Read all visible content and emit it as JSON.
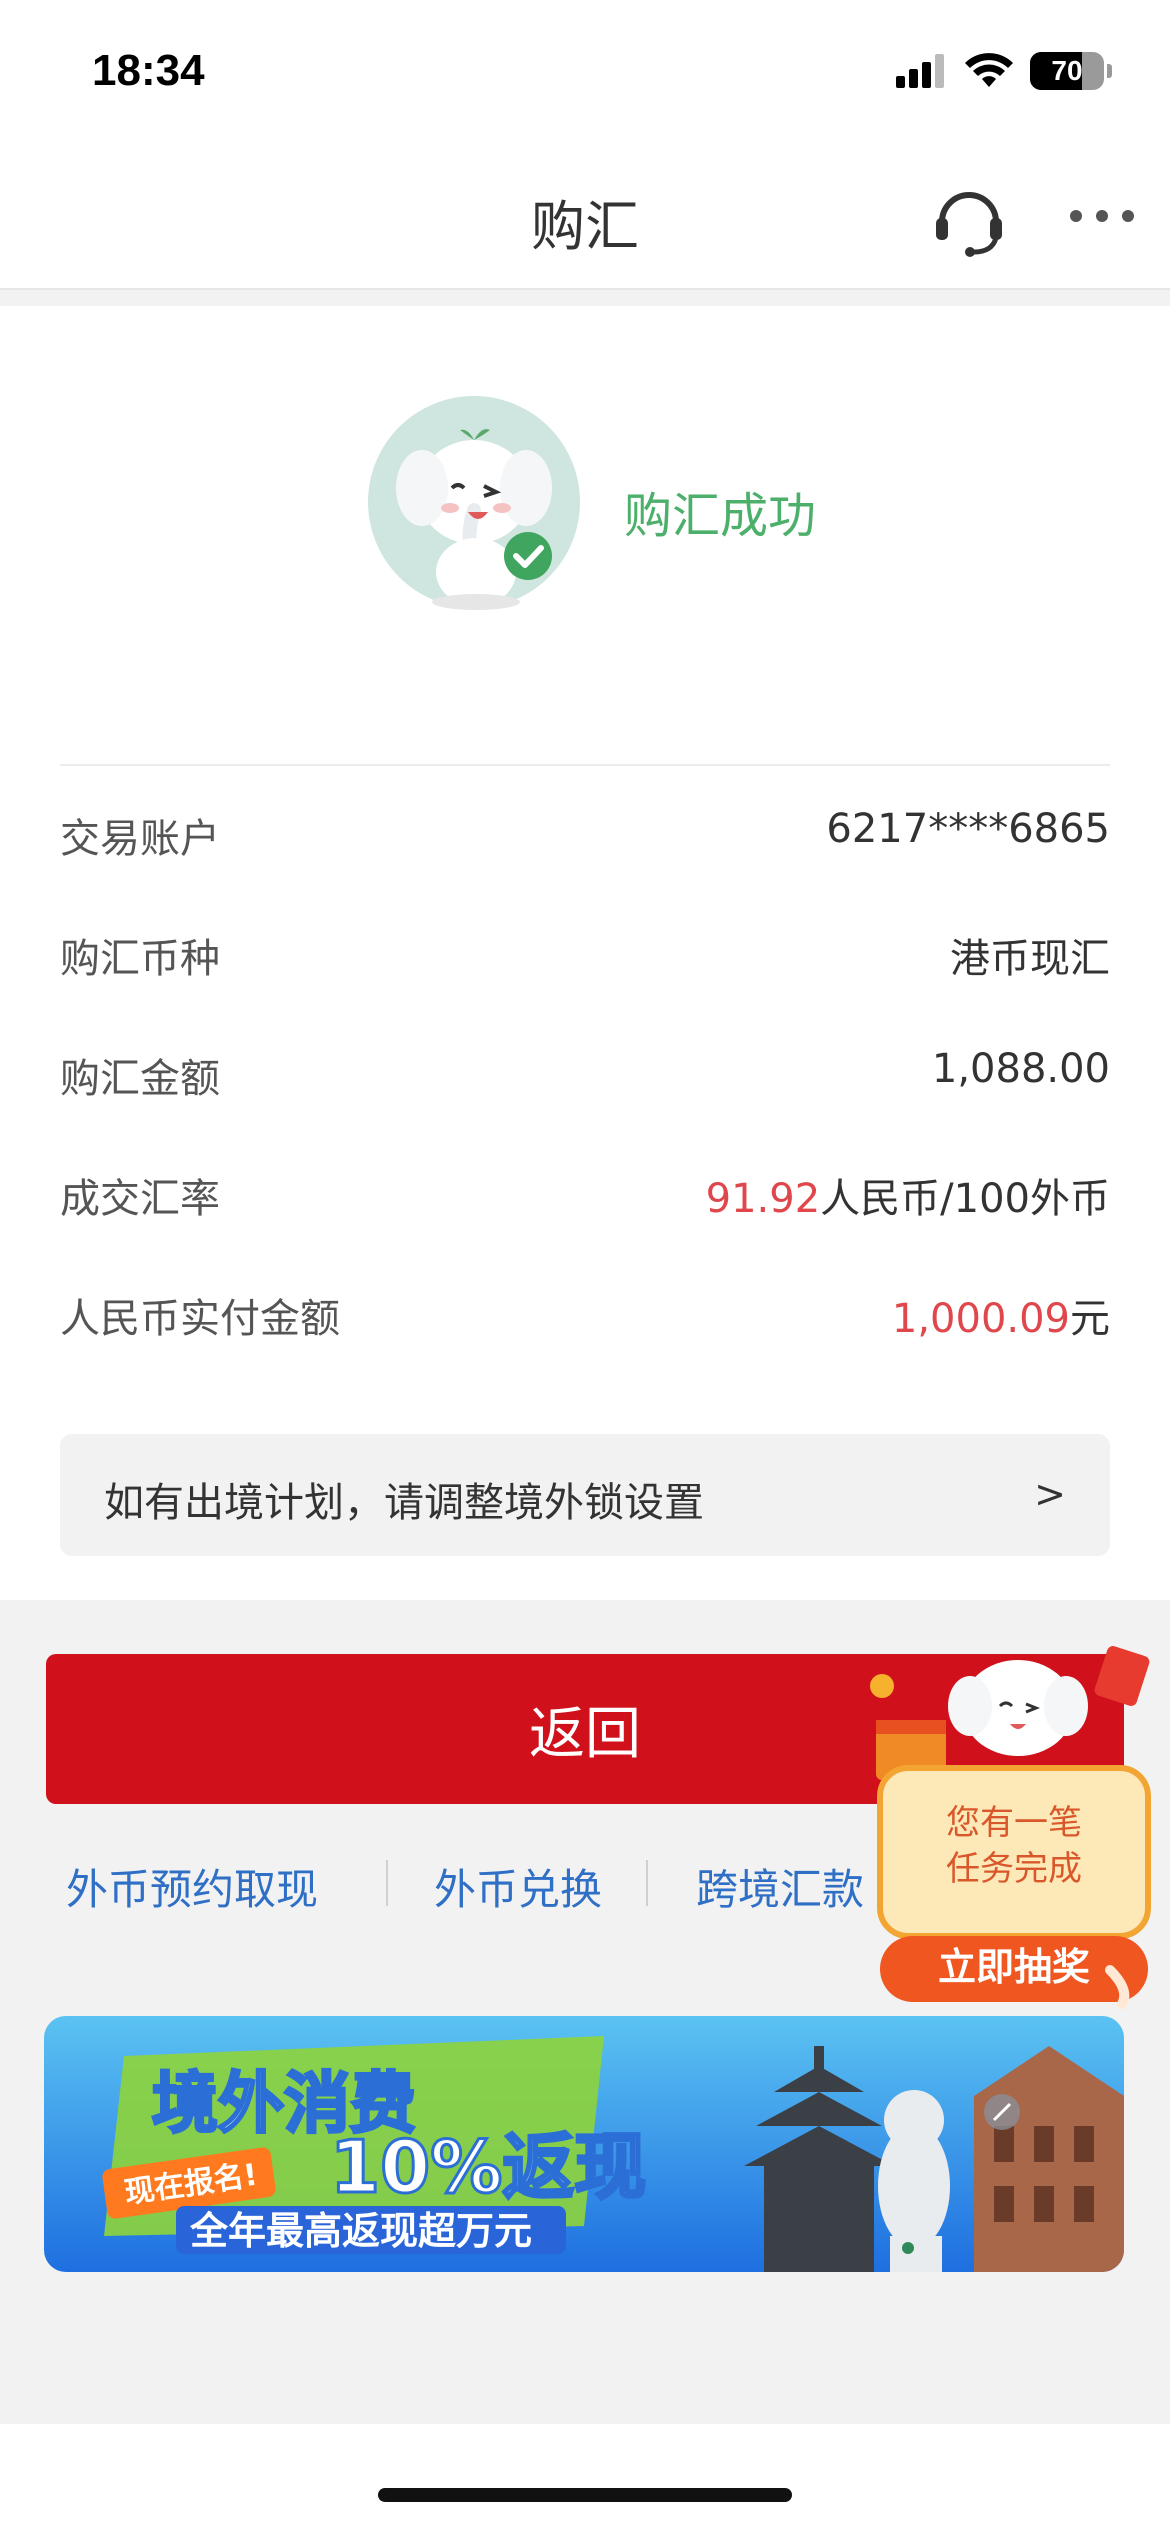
{
  "status_bar": {
    "time": "18:34",
    "battery": "70",
    "battery_level": 0.7
  },
  "nav": {
    "title": "购汇"
  },
  "result": {
    "status_text": "购汇成功"
  },
  "details": {
    "rows": [
      {
        "label": "交易账户",
        "value": "6217****6865"
      },
      {
        "label": "购汇币种",
        "value": "港币现汇"
      },
      {
        "label": "购汇金额",
        "value": "1,088.00"
      },
      {
        "label": "成交汇率",
        "value_highlight": "91.92",
        "value_suffix": "人民币/100外币"
      },
      {
        "label": "人民币实付金额",
        "value_highlight": "1,000.09",
        "value_suffix": "元"
      }
    ]
  },
  "notice": {
    "text": "如有出境计划，请调整境外锁设置",
    "arrow": ">"
  },
  "actions": {
    "return_label": "返回",
    "links": [
      "外币预约取现",
      "外币兑换",
      "跨境汇款"
    ]
  },
  "floating_widget": {
    "line1": "您有一笔",
    "line2": "任务完成",
    "button": "立即抽奖"
  },
  "banner": {
    "title": "境外消费",
    "tag": "现在报名!",
    "highlight": "10%返现",
    "subtitle": "全年最高返现超万元"
  },
  "colors": {
    "primary_red": "#d0101b",
    "amount_red": "#e0474c",
    "success_green": "#4caf6a",
    "link_blue": "#2f6fc6"
  }
}
